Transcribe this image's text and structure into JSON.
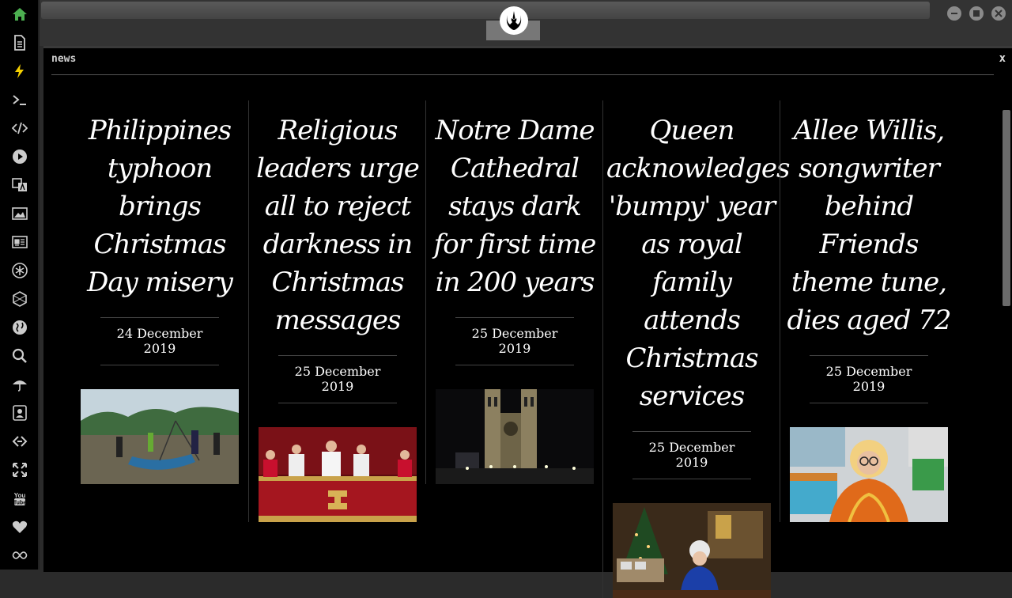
{
  "sidebar": {
    "items": [
      {
        "name": "home-icon",
        "color": "#4caf50"
      },
      {
        "name": "document-icon"
      },
      {
        "name": "lightning-icon",
        "color": "#f5d000"
      },
      {
        "name": "terminal-icon"
      },
      {
        "name": "code-icon"
      },
      {
        "name": "play-icon"
      },
      {
        "name": "translate-icon"
      },
      {
        "name": "image-icon"
      },
      {
        "name": "newspaper-icon"
      },
      {
        "name": "asterisk-icon"
      },
      {
        "name": "hexagon-icon"
      },
      {
        "name": "globe-icon"
      },
      {
        "name": "search-icon"
      },
      {
        "name": "umbrella-icon"
      },
      {
        "name": "contact-card-icon"
      },
      {
        "name": "link-icon"
      },
      {
        "name": "expand-icon"
      },
      {
        "name": "youtube-icon"
      },
      {
        "name": "heart-icon"
      },
      {
        "name": "infinity-icon"
      }
    ]
  },
  "window": {
    "title": "news",
    "close": "x"
  },
  "articles": [
    {
      "headline": "Philippines typhoon brings Christmas Day misery",
      "date": "24 December 2019",
      "image": "typhoon-photo"
    },
    {
      "headline": "Religious leaders urge all to reject darkness in Christmas messages",
      "date": "25 December 2019",
      "image": "pope-balcony-photo"
    },
    {
      "headline": "Notre Dame Cathedral stays dark for first time in 200 years",
      "date": "25 December 2019",
      "image": "notre-dame-photo"
    },
    {
      "headline": "Queen acknowledges 'bumpy' year as royal family attends Christmas services",
      "date": "25 December 2019",
      "image": "queen-photo"
    },
    {
      "headline": "Allee Willis, songwriter behind Friends theme tune, dies aged 72",
      "date": "25 December 2019",
      "image": "allee-willis-photo"
    }
  ]
}
